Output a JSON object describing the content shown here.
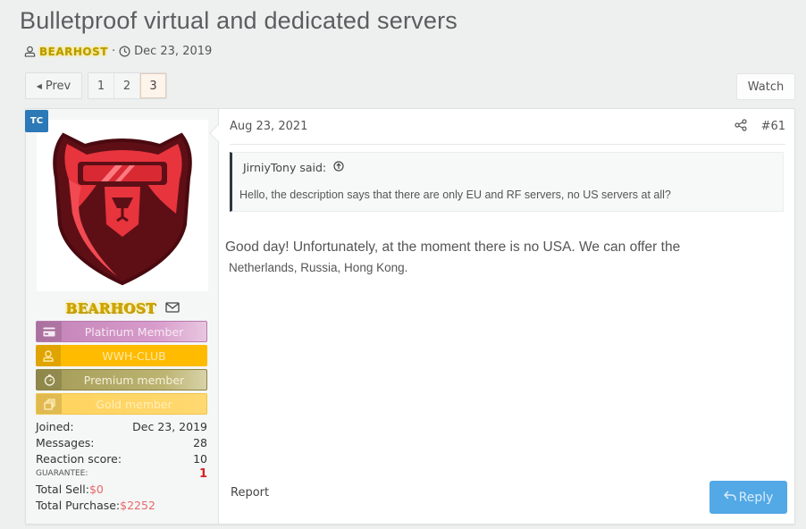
{
  "thread": {
    "title": "Bulletproof virtual and dedicated servers",
    "author": "BEARHOST",
    "separator": "·",
    "date": "Dec 23, 2019"
  },
  "pagination": {
    "prev_label": "Prev",
    "pages": [
      "1",
      "2",
      "3"
    ],
    "current_page": "3"
  },
  "watch_label": "Watch",
  "post": {
    "user": {
      "badge": "TC",
      "name": "BEARHOST",
      "banners": [
        {
          "label": "Platinum Member",
          "icon": "credit-card-icon"
        },
        {
          "label": "WWH-CLUB",
          "icon": "user-icon"
        },
        {
          "label": "Premium member",
          "icon": "stopwatch-icon"
        },
        {
          "label": "Gold member",
          "icon": "stack-icon"
        }
      ],
      "stats": {
        "joined_label": "Joined:",
        "joined_value": "Dec 23, 2019",
        "messages_label": "Messages:",
        "messages_value": "28",
        "reaction_label": "Reaction score:",
        "reaction_value": "10",
        "guarantee_label": "GUARANTEE:",
        "guarantee_value": "1",
        "total_sell_label": "Total Sell:",
        "total_sell_value": "$0",
        "total_purchase_label": "Total Purchase:",
        "total_purchase_value": "$2252"
      }
    },
    "date": "Aug 23, 2021",
    "number": "#61",
    "quote": {
      "author_said": "JirniyTony said:",
      "text": "Hello, the description says that there are only EU and RF servers, no US servers at all?"
    },
    "message": {
      "line1": "Good day! Unfortunately, at the moment there is no USA. We can offer the",
      "line2": "Netherlands, Russia, Hong Kong."
    },
    "report_label": "Report",
    "reply_label": "Reply"
  },
  "colors": {
    "accent_blue": "#53a8e6",
    "badge_blue": "#2b79b7",
    "guarantee_red": "#d32222",
    "money_red": "#e86868",
    "username_gold": "#cda300"
  }
}
